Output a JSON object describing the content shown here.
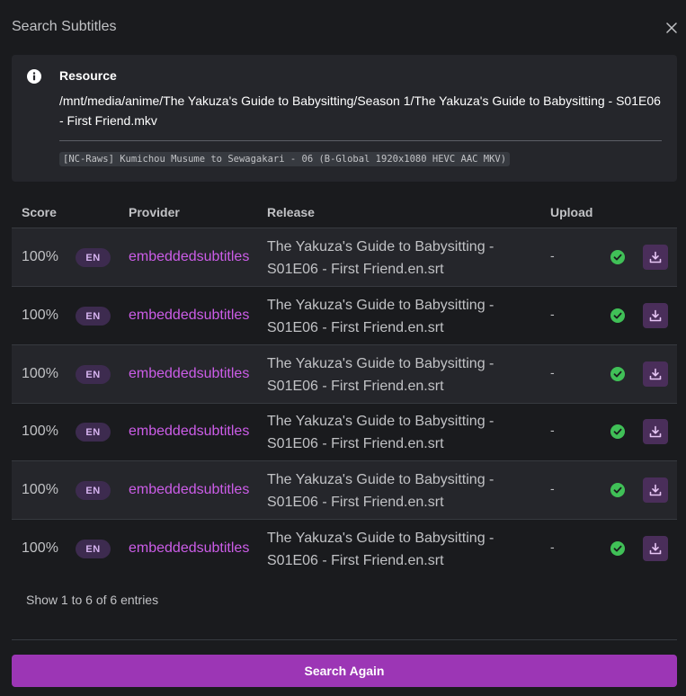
{
  "modal": {
    "title": "Search Subtitles",
    "close_icon": "close-icon"
  },
  "resource": {
    "icon": "info-icon",
    "title": "Resource",
    "path": "/mnt/media/anime/The Yakuza's Guide to Babysitting/Season 1/The Yakuza's Guide to Babysitting - S01E06 - First Friend.mkv",
    "release_name": "[NC-Raws] Kumichou Musume to Sewagakari - 06 (B-Global 1920x1080 HEVC AAC MKV)"
  },
  "table": {
    "headers": {
      "score": "Score",
      "provider": "Provider",
      "release": "Release",
      "upload": "Upload"
    },
    "rows": [
      {
        "score": "100%",
        "language": "EN",
        "provider": "embeddedsubtitles",
        "release": "The Yakuza's Guide to Babysitting - S01E06 - First Friend.en.srt",
        "upload": "-"
      },
      {
        "score": "100%",
        "language": "EN",
        "provider": "embeddedsubtitles",
        "release": "The Yakuza's Guide to Babysitting - S01E06 - First Friend.en.srt",
        "upload": "-"
      },
      {
        "score": "100%",
        "language": "EN",
        "provider": "embeddedsubtitles",
        "release": "The Yakuza's Guide to Babysitting - S01E06 - First Friend.en.srt",
        "upload": "-"
      },
      {
        "score": "100%",
        "language": "EN",
        "provider": "embeddedsubtitles",
        "release": "The Yakuza's Guide to Babysitting - S01E06 - First Friend.en.srt",
        "upload": "-"
      },
      {
        "score": "100%",
        "language": "EN",
        "provider": "embeddedsubtitles",
        "release": "The Yakuza's Guide to Babysitting - S01E06 - First Friend.en.srt",
        "upload": "-"
      },
      {
        "score": "100%",
        "language": "EN",
        "provider": "embeddedsubtitles",
        "release": "The Yakuza's Guide to Babysitting - S01E06 - First Friend.en.srt",
        "upload": "-"
      }
    ]
  },
  "footer": {
    "entries_text": "Show 1 to 6 of 6 entries",
    "search_again_label": "Search Again"
  },
  "colors": {
    "background": "#1a1b1e",
    "panel": "#25262b",
    "accent": "#9c36b5",
    "provider_link": "#cc5de8",
    "success": "#40c057"
  }
}
